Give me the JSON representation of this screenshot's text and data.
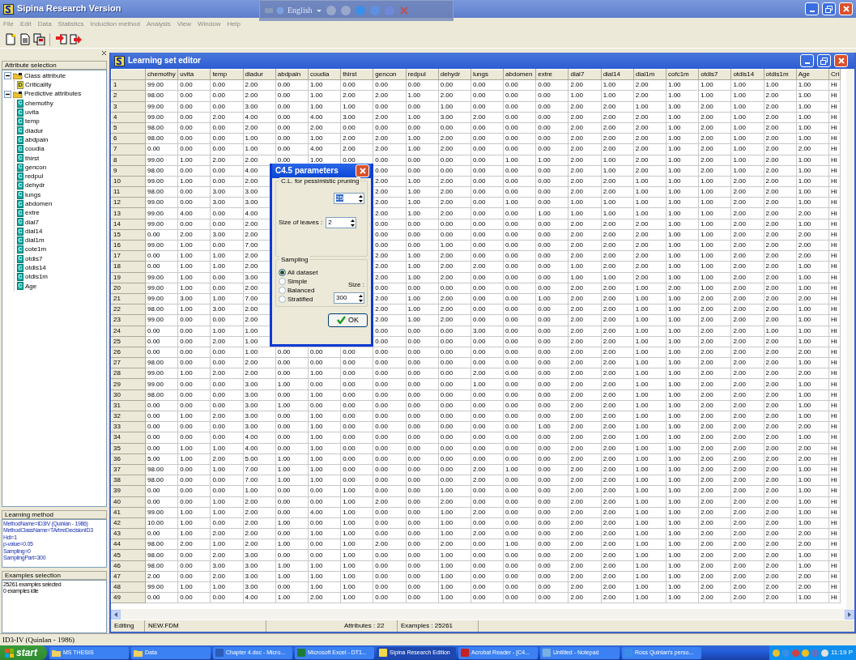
{
  "window": {
    "title": "Sipina Research Version"
  },
  "language_bar": {
    "label": "English"
  },
  "menu": [
    "File",
    "Edit",
    "Data",
    "Statistics",
    "Induction method",
    "Analysis",
    "View",
    "Window",
    "Help"
  ],
  "toolbar": [
    {
      "kind": "new"
    },
    {
      "kind": "open"
    },
    {
      "kind": "save"
    },
    {
      "kind": "import"
    },
    {
      "kind": "export"
    }
  ],
  "sidebar": {
    "attribute_title": "Attribute selection",
    "tree": [
      {
        "label": "Class attribute",
        "expanded": true,
        "children": [
          {
            "label": "Criticality",
            "letter": "D",
            "kind": "discrete"
          }
        ]
      },
      {
        "label": "Predictive attributes",
        "expanded": true,
        "children": [
          {
            "label": "chemothy",
            "letter": "C",
            "kind": "continuous"
          },
          {
            "label": "uvita",
            "letter": "C",
            "kind": "continuous"
          },
          {
            "label": "temp",
            "letter": "C",
            "kind": "continuous"
          },
          {
            "label": "diadur",
            "letter": "C",
            "kind": "continuous"
          },
          {
            "label": "abdpain",
            "letter": "C",
            "kind": "continuous"
          },
          {
            "label": "coudia",
            "letter": "C",
            "kind": "continuous"
          },
          {
            "label": "thirst",
            "letter": "C",
            "kind": "continuous"
          },
          {
            "label": "gencon",
            "letter": "C",
            "kind": "continuous"
          },
          {
            "label": "redpul",
            "letter": "C",
            "kind": "continuous"
          },
          {
            "label": "dehydr",
            "letter": "C",
            "kind": "continuous"
          },
          {
            "label": "lungs",
            "letter": "C",
            "kind": "continuous"
          },
          {
            "label": "abdomen",
            "letter": "C",
            "kind": "continuous"
          },
          {
            "label": "extre",
            "letter": "C",
            "kind": "continuous"
          },
          {
            "label": "dial7",
            "letter": "C",
            "kind": "continuous"
          },
          {
            "label": "dial14",
            "letter": "C",
            "kind": "continuous"
          },
          {
            "label": "dial1m",
            "letter": "C",
            "kind": "continuous"
          },
          {
            "label": "cote1m",
            "letter": "C",
            "kind": "continuous"
          },
          {
            "label": "otdis7",
            "letter": "C",
            "kind": "continuous"
          },
          {
            "label": "otdis14",
            "letter": "C",
            "kind": "continuous"
          },
          {
            "label": "otdis1m",
            "letter": "C",
            "kind": "continuous"
          },
          {
            "label": "Age",
            "letter": "C",
            "kind": "continuous"
          }
        ]
      }
    ],
    "method_title": "Learning method",
    "method_lines": [
      "MethodName=ID3IV (Quinlan - 1986)",
      "MethodClassName=TArbreDecisionID3",
      "Hdl=1",
      "p-value=0.05",
      "Sampling=0",
      "SamplingPart=300"
    ],
    "examples_title": "Examples selection",
    "examples_lines": [
      "25261 examples selected",
      "0 examples idle"
    ]
  },
  "editor": {
    "title": "Learning set editor",
    "table": {
      "columns": [
        "chemothy",
        "uvita",
        "temp",
        "diadur",
        "abdpain",
        "coudia",
        "thirst",
        "gencon",
        "redpul",
        "dehydr",
        "lungs",
        "abdomen",
        "extre",
        "dial7",
        "dial14",
        "dial1m",
        "cofc1m",
        "otdis7",
        "otdis14",
        "otdis1m",
        "Age",
        "Cri"
      ],
      "rows": [
        {
          "header": "1",
          "cells": [
            "99.00",
            "0.00",
            "0.00",
            "2.00",
            "0.00",
            "1.00",
            "0.00",
            "0.00",
            "0.00",
            "0.00",
            "0.00",
            "0.00",
            "0.00",
            "2.00",
            "1.00",
            "2.00",
            "1.00",
            "1.00",
            "1.00",
            "1.00",
            "1.00",
            "Hi"
          ]
        },
        {
          "header": "2",
          "cells": [
            "98.00",
            "0.00",
            "0.00",
            "2.00",
            "0.00",
            "1.00",
            "2.00",
            "2.00",
            "1.00",
            "2.00",
            "0.00",
            "0.00",
            "0.00",
            "1.00",
            "1.00",
            "2.00",
            "1.00",
            "1.00",
            "1.00",
            "2.00",
            "1.00",
            "Hi"
          ]
        },
        {
          "header": "3",
          "cells": [
            "99.00",
            "0.00",
            "0.00",
            "3.00",
            "0.00",
            "1.00",
            "1.00",
            "0.00",
            "0.00",
            "1.00",
            "0.00",
            "0.00",
            "0.00",
            "2.00",
            "2.00",
            "1.00",
            "1.00",
            "2.00",
            "1.00",
            "2.00",
            "1.00",
            "Hi"
          ]
        },
        {
          "header": "4",
          "cells": [
            "99.00",
            "0.00",
            "2.00",
            "4.00",
            "0.00",
            "4.00",
            "3.00",
            "2.00",
            "1.00",
            "3.00",
            "2.00",
            "0.00",
            "0.00",
            "2.00",
            "2.00",
            "2.00",
            "1.00",
            "2.00",
            "1.00",
            "2.00",
            "1.00",
            "Hi"
          ]
        },
        {
          "header": "5",
          "cells": [
            "98.00",
            "0.00",
            "0.00",
            "2.00",
            "0.00",
            "2.00",
            "0.00",
            "0.00",
            "0.00",
            "0.00",
            "0.00",
            "0.00",
            "0.00",
            "2.00",
            "2.00",
            "2.00",
            "1.00",
            "2.00",
            "1.00",
            "2.00",
            "1.00",
            "Hi"
          ]
        },
        {
          "header": "6",
          "cells": [
            "98.00",
            "0.00",
            "0.00",
            "1.00",
            "0.00",
            "1.00",
            "2.00",
            "2.00",
            "1.00",
            "2.00",
            "0.00",
            "0.00",
            "0.00",
            "2.00",
            "2.00",
            "2.00",
            "1.00",
            "2.00",
            "1.00",
            "2.00",
            "1.00",
            "Hi"
          ]
        },
        {
          "header": "7",
          "cells": [
            "0.00",
            "0.00",
            "0.00",
            "1.00",
            "0.00",
            "4.00",
            "2.00",
            "2.00",
            "1.00",
            "2.00",
            "0.00",
            "0.00",
            "0.00",
            "2.00",
            "2.00",
            "2.00",
            "1.00",
            "2.00",
            "1.00",
            "2.00",
            "2.00",
            "Hi"
          ]
        },
        {
          "header": "8",
          "cells": [
            "99.00",
            "1.00",
            "2.00",
            "2.00",
            "0.00",
            "1.00",
            "0.00",
            "0.00",
            "0.00",
            "0.00",
            "0.00",
            "1.00",
            "1.00",
            "2.00",
            "1.00",
            "2.00",
            "1.00",
            "2.00",
            "1.00",
            "2.00",
            "1.00",
            "Hi"
          ]
        },
        {
          "header": "9",
          "cells": [
            "98.00",
            "0.00",
            "0.00",
            "4.00",
            null,
            null,
            null,
            "0.00",
            "0.00",
            "0.00",
            "0.00",
            "0.00",
            "0.00",
            "2.00",
            "1.00",
            "2.00",
            "1.00",
            "2.00",
            "1.00",
            "2.00",
            "1.00",
            "Hi"
          ]
        },
        {
          "header": "10",
          "cells": [
            "99.00",
            "1.00",
            "0.00",
            "2.00",
            null,
            null,
            null,
            "2.00",
            "1.00",
            "2.00",
            "0.00",
            "0.00",
            "0.00",
            "2.00",
            "2.00",
            "1.00",
            "1.00",
            "1.00",
            "2.00",
            "2.00",
            "1.00",
            "Hi"
          ]
        },
        {
          "header": "11",
          "cells": [
            "98.00",
            "0.00",
            "3.00",
            "3.00",
            null,
            null,
            null,
            "2.00",
            "1.00",
            "2.00",
            "0.00",
            "0.00",
            "0.00",
            "2.00",
            "2.00",
            "1.00",
            "1.00",
            "1.00",
            "2.00",
            "2.00",
            "1.00",
            "Hi"
          ]
        },
        {
          "header": "12",
          "cells": [
            "99.00",
            "0.00",
            "3.00",
            "3.00",
            null,
            null,
            null,
            "2.00",
            "1.00",
            "2.00",
            "0.00",
            "1.00",
            "0.00",
            "1.00",
            "1.00",
            "1.00",
            "1.00",
            "1.00",
            "2.00",
            "2.00",
            "1.00",
            "Hi"
          ]
        },
        {
          "header": "13",
          "cells": [
            "99.00",
            "4.00",
            "0.00",
            "4.00",
            null,
            null,
            null,
            "2.00",
            "1.00",
            "2.00",
            "0.00",
            "0.00",
            "1.00",
            "1.00",
            "1.00",
            "1.00",
            "1.00",
            "1.00",
            "2.00",
            "2.00",
            "2.00",
            "Hi"
          ]
        },
        {
          "header": "14",
          "cells": [
            "99.00",
            "0.00",
            "0.00",
            "2.00",
            null,
            null,
            null,
            "0.00",
            "0.00",
            "0.00",
            "0.00",
            "0.00",
            "0.00",
            "2.00",
            "2.00",
            "2.00",
            "1.00",
            "1.00",
            "2.00",
            "2.00",
            "1.00",
            "Hi"
          ]
        },
        {
          "header": "15",
          "cells": [
            "0.00",
            "2.00",
            "3.00",
            "2.00",
            null,
            null,
            null,
            "0.00",
            "0.00",
            "0.00",
            "0.00",
            "0.00",
            "0.00",
            "2.00",
            "2.00",
            "2.00",
            "1.00",
            "1.00",
            "2.00",
            "2.00",
            "2.00",
            "Hi"
          ]
        },
        {
          "header": "16",
          "cells": [
            "99.00",
            "1.00",
            "0.00",
            "7.00",
            null,
            null,
            null,
            "0.00",
            "0.00",
            "1.00",
            "0.00",
            "0.00",
            "0.00",
            "2.00",
            "2.00",
            "2.00",
            "1.00",
            "1.00",
            "2.00",
            "2.00",
            "2.00",
            "Hi"
          ]
        },
        {
          "header": "17",
          "cells": [
            "0.00",
            "1.00",
            "1.00",
            "2.00",
            null,
            null,
            null,
            "2.00",
            "1.00",
            "2.00",
            "0.00",
            "0.00",
            "0.00",
            "2.00",
            "2.00",
            "2.00",
            "1.00",
            "1.00",
            "2.00",
            "2.00",
            "2.00",
            "Hi"
          ]
        },
        {
          "header": "18",
          "cells": [
            "0.00",
            "1.00",
            "1.00",
            "2.00",
            null,
            null,
            null,
            "2.00",
            "1.00",
            "2.00",
            "2.00",
            "0.00",
            "0.00",
            "1.00",
            "2.00",
            "2.00",
            "1.00",
            "1.00",
            "2.00",
            "2.00",
            "1.00",
            "Hi"
          ]
        },
        {
          "header": "19",
          "cells": [
            "99.00",
            "1.00",
            "0.00",
            "3.00",
            null,
            null,
            null,
            "2.00",
            "1.00",
            "2.00",
            "0.00",
            "0.00",
            "0.00",
            "1.00",
            "1.00",
            "2.00",
            "1.00",
            "1.00",
            "2.00",
            "2.00",
            "1.00",
            "Hi"
          ]
        },
        {
          "header": "20",
          "cells": [
            "99.00",
            "1.00",
            "0.00",
            "2.00",
            null,
            null,
            null,
            "0.00",
            "0.00",
            "0.00",
            "0.00",
            "0.00",
            "0.00",
            "2.00",
            "2.00",
            "1.00",
            "2.00",
            "1.00",
            "2.00",
            "2.00",
            "1.00",
            "Hi"
          ]
        },
        {
          "header": "21",
          "cells": [
            "99.00",
            "3.00",
            "1.00",
            "7.00",
            null,
            null,
            null,
            "2.00",
            "1.00",
            "2.00",
            "0.00",
            "0.00",
            "1.00",
            "2.00",
            "2.00",
            "1.00",
            "1.00",
            "2.00",
            "2.00",
            "2.00",
            "2.00",
            "Hi"
          ]
        },
        {
          "header": "22",
          "cells": [
            "98.00",
            "1.00",
            "3.00",
            "2.00",
            null,
            null,
            null,
            "2.00",
            "1.00",
            "2.00",
            "0.00",
            "0.00",
            "0.00",
            "2.00",
            "2.00",
            "1.00",
            "1.00",
            "2.00",
            "2.00",
            "2.00",
            "1.00",
            "Hi"
          ]
        },
        {
          "header": "23",
          "cells": [
            "99.00",
            "0.00",
            "0.00",
            "2.00",
            null,
            null,
            null,
            "2.00",
            "1.00",
            "2.00",
            "0.00",
            "0.00",
            "0.00",
            "2.00",
            "2.00",
            "1.00",
            "1.00",
            "2.00",
            "2.00",
            "2.00",
            "1.00",
            "Hi"
          ]
        },
        {
          "header": "24",
          "cells": [
            "0.00",
            "0.00",
            "1.00",
            "1.00",
            null,
            null,
            null,
            "0.00",
            "0.00",
            "0.00",
            "3.00",
            "0.00",
            "0.00",
            "2.00",
            "2.00",
            "1.00",
            "1.00",
            "2.00",
            "2.00",
            "1.00",
            "1.00",
            "Hi"
          ]
        },
        {
          "header": "25",
          "cells": [
            "0.00",
            "0.00",
            "2.00",
            "1.00",
            null,
            null,
            null,
            "0.00",
            "0.00",
            "0.00",
            "0.00",
            "0.00",
            "0.00",
            "2.00",
            "2.00",
            "1.00",
            "1.00",
            "2.00",
            "2.00",
            "2.00",
            "1.00",
            "Hi"
          ]
        },
        {
          "header": "26",
          "cells": [
            "0.00",
            "0.00",
            "0.00",
            "1.00",
            "0.00",
            "0.00",
            "0.00",
            "0.00",
            "0.00",
            "0.00",
            "0.00",
            "0.00",
            "0.00",
            "2.00",
            "2.00",
            "1.00",
            "1.00",
            "2.00",
            "2.00",
            "2.00",
            "2.00",
            "Hi"
          ]
        },
        {
          "header": "27",
          "cells": [
            "98.00",
            "0.00",
            "0.00",
            "2.00",
            "0.00",
            "0.00",
            "0.00",
            "0.00",
            "0.00",
            "0.00",
            "0.00",
            "0.00",
            "0.00",
            "2.00",
            "2.00",
            "1.00",
            "1.00",
            "2.00",
            "2.00",
            "2.00",
            "1.00",
            "Hi"
          ]
        },
        {
          "header": "28",
          "cells": [
            "99.00",
            "1.00",
            "2.00",
            "2.00",
            "0.00",
            "1.00",
            "0.00",
            "0.00",
            "0.00",
            "0.00",
            "2.00",
            "0.00",
            "0.00",
            "2.00",
            "2.00",
            "1.00",
            "1.00",
            "2.00",
            "2.00",
            "2.00",
            "2.00",
            "Hi"
          ]
        },
        {
          "header": "29",
          "cells": [
            "99.00",
            "0.00",
            "0.00",
            "3.00",
            "1.00",
            "0.00",
            "0.00",
            "0.00",
            "0.00",
            "0.00",
            "1.00",
            "0.00",
            "0.00",
            "2.00",
            "2.00",
            "1.00",
            "1.00",
            "2.00",
            "2.00",
            "2.00",
            "1.00",
            "Hi"
          ]
        },
        {
          "header": "30",
          "cells": [
            "98.00",
            "0.00",
            "0.00",
            "3.00",
            "0.00",
            "1.00",
            "0.00",
            "0.00",
            "0.00",
            "0.00",
            "0.00",
            "0.00",
            "0.00",
            "2.00",
            "2.00",
            "1.00",
            "1.00",
            "2.00",
            "2.00",
            "2.00",
            "1.00",
            "Hi"
          ]
        },
        {
          "header": "31",
          "cells": [
            "0.00",
            "0.00",
            "0.00",
            "3.00",
            "1.00",
            "0.00",
            "0.00",
            "0.00",
            "0.00",
            "0.00",
            "0.00",
            "0.00",
            "0.00",
            "2.00",
            "2.00",
            "1.00",
            "1.00",
            "2.00",
            "2.00",
            "2.00",
            "1.00",
            "Hi"
          ]
        },
        {
          "header": "32",
          "cells": [
            "0.00",
            "1.00",
            "2.00",
            "3.00",
            "0.00",
            "1.00",
            "0.00",
            "0.00",
            "0.00",
            "0.00",
            "0.00",
            "0.00",
            "0.00",
            "2.00",
            "2.00",
            "1.00",
            "1.00",
            "2.00",
            "2.00",
            "2.00",
            "1.00",
            "Hi"
          ]
        },
        {
          "header": "33",
          "cells": [
            "0.00",
            "0.00",
            "0.00",
            "3.00",
            "0.00",
            "1.00",
            "0.00",
            "0.00",
            "0.00",
            "0.00",
            "0.00",
            "0.00",
            "1.00",
            "2.00",
            "2.00",
            "1.00",
            "1.00",
            "2.00",
            "2.00",
            "2.00",
            "2.00",
            "Hi"
          ]
        },
        {
          "header": "34",
          "cells": [
            "0.00",
            "0.00",
            "0.00",
            "4.00",
            "0.00",
            "1.00",
            "0.00",
            "0.00",
            "0.00",
            "0.00",
            "0.00",
            "0.00",
            "0.00",
            "2.00",
            "2.00",
            "1.00",
            "1.00",
            "2.00",
            "2.00",
            "2.00",
            "1.00",
            "Hi"
          ]
        },
        {
          "header": "35",
          "cells": [
            "0.00",
            "1.00",
            "1.00",
            "4.00",
            "0.00",
            "1.00",
            "0.00",
            "0.00",
            "0.00",
            "0.00",
            "0.00",
            "0.00",
            "0.00",
            "2.00",
            "2.00",
            "1.00",
            "1.00",
            "2.00",
            "2.00",
            "2.00",
            "2.00",
            "Hi"
          ]
        },
        {
          "header": "36",
          "cells": [
            "5.00",
            "1.00",
            "2.00",
            "5.00",
            "1.00",
            "1.00",
            "0.00",
            "0.00",
            "0.00",
            "0.00",
            "0.00",
            "0.00",
            "0.00",
            "2.00",
            "2.00",
            "1.00",
            "1.00",
            "2.00",
            "2.00",
            "2.00",
            "2.00",
            "Hi"
          ]
        },
        {
          "header": "37",
          "cells": [
            "98.00",
            "0.00",
            "1.00",
            "7.00",
            "1.00",
            "1.00",
            "0.00",
            "0.00",
            "0.00",
            "0.00",
            "2.00",
            "1.00",
            "0.00",
            "2.00",
            "2.00",
            "1.00",
            "1.00",
            "2.00",
            "2.00",
            "2.00",
            "1.00",
            "Hi"
          ]
        },
        {
          "header": "38",
          "cells": [
            "98.00",
            "0.00",
            "0.00",
            "7.00",
            "1.00",
            "1.00",
            "0.00",
            "0.00",
            "0.00",
            "0.00",
            "2.00",
            "0.00",
            "0.00",
            "2.00",
            "2.00",
            "1.00",
            "1.00",
            "2.00",
            "2.00",
            "2.00",
            "1.00",
            "Hi"
          ]
        },
        {
          "header": "39",
          "cells": [
            "0.00",
            "0.00",
            "0.00",
            "1.00",
            "0.00",
            "0.00",
            "1.00",
            "0.00",
            "0.00",
            "1.00",
            "0.00",
            "0.00",
            "0.00",
            "2.00",
            "2.00",
            "1.00",
            "1.00",
            "2.00",
            "2.00",
            "2.00",
            "1.00",
            "Hi"
          ]
        },
        {
          "header": "40",
          "cells": [
            "0.00",
            "0.00",
            "1.00",
            "2.00",
            "0.00",
            "0.00",
            "1.00",
            "2.00",
            "0.00",
            "2.00",
            "0.00",
            "0.00",
            "0.00",
            "2.00",
            "2.00",
            "1.00",
            "1.00",
            "2.00",
            "2.00",
            "2.00",
            "1.00",
            "Hi"
          ]
        },
        {
          "header": "41",
          "cells": [
            "99.00",
            "1.00",
            "1.00",
            "2.00",
            "0.00",
            "4.00",
            "1.00",
            "0.00",
            "0.00",
            "1.00",
            "2.00",
            "0.00",
            "0.00",
            "2.00",
            "2.00",
            "1.00",
            "1.00",
            "2.00",
            "2.00",
            "2.00",
            "1.00",
            "Hi"
          ]
        },
        {
          "header": "42",
          "cells": [
            "10.00",
            "1.00",
            "0.00",
            "2.00",
            "1.00",
            "0.00",
            "1.00",
            "0.00",
            "0.00",
            "1.00",
            "0.00",
            "0.00",
            "0.00",
            "2.00",
            "2.00",
            "1.00",
            "1.00",
            "2.00",
            "2.00",
            "2.00",
            "1.00",
            "Hi"
          ]
        },
        {
          "header": "43",
          "cells": [
            "0.00",
            "1.00",
            "2.00",
            "2.00",
            "0.00",
            "1.00",
            "1.00",
            "0.00",
            "0.00",
            "1.00",
            "2.00",
            "0.00",
            "0.00",
            "2.00",
            "2.00",
            "1.00",
            "1.00",
            "2.00",
            "2.00",
            "2.00",
            "2.00",
            "Hi"
          ]
        },
        {
          "header": "44",
          "cells": [
            "98.00",
            "2.00",
            "1.00",
            "2.00",
            "1.00",
            "0.00",
            "1.00",
            "2.00",
            "0.00",
            "2.00",
            "0.00",
            "1.00",
            "0.00",
            "2.00",
            "2.00",
            "1.00",
            "1.00",
            "2.00",
            "2.00",
            "2.00",
            "2.00",
            "Hi"
          ]
        },
        {
          "header": "45",
          "cells": [
            "98.00",
            "0.00",
            "2.00",
            "3.00",
            "0.00",
            "0.00",
            "1.00",
            "0.00",
            "0.00",
            "1.00",
            "0.00",
            "0.00",
            "0.00",
            "2.00",
            "2.00",
            "1.00",
            "1.00",
            "2.00",
            "2.00",
            "2.00",
            "1.00",
            "Hi"
          ]
        },
        {
          "header": "46",
          "cells": [
            "98.00",
            "0.00",
            "3.00",
            "3.00",
            "1.00",
            "1.00",
            "1.00",
            "0.00",
            "0.00",
            "1.00",
            "0.00",
            "0.00",
            "0.00",
            "2.00",
            "2.00",
            "1.00",
            "1.00",
            "2.00",
            "2.00",
            "2.00",
            "1.00",
            "Hi"
          ]
        },
        {
          "header": "47",
          "cells": [
            "2.00",
            "0.00",
            "2.00",
            "3.00",
            "1.00",
            "1.00",
            "1.00",
            "0.00",
            "0.00",
            "1.00",
            "0.00",
            "0.00",
            "0.00",
            "2.00",
            "2.00",
            "1.00",
            "1.00",
            "2.00",
            "2.00",
            "2.00",
            "2.00",
            "Hi"
          ]
        },
        {
          "header": "48",
          "cells": [
            "99.00",
            "1.00",
            "1.00",
            "3.00",
            "0.00",
            "1.00",
            "1.00",
            "0.00",
            "0.00",
            "1.00",
            "0.00",
            "0.00",
            "0.00",
            "2.00",
            "2.00",
            "1.00",
            "1.00",
            "2.00",
            "2.00",
            "2.00",
            "2.00",
            "Hi"
          ]
        },
        {
          "header": "49",
          "cells": [
            "0.00",
            "0.00",
            "0.00",
            "4.00",
            "1.00",
            "2.00",
            "1.00",
            "0.00",
            "0.00",
            "1.00",
            "0.00",
            "0.00",
            "0.00",
            "2.00",
            "2.00",
            "1.00",
            "1.00",
            "2.00",
            "2.00",
            "2.00",
            "1.00",
            "Hi"
          ]
        }
      ]
    },
    "status": [
      "Editing",
      "NEW.FDM",
      "Attributes : 22",
      "Examples : 25261"
    ]
  },
  "dialog": {
    "title": "C4.5 parameters",
    "cl_group": "C.L. for pessimistic pruning",
    "cl_value": "25",
    "leaves_label": "Size of leaves :",
    "leaves_value": "2",
    "sampling_group": "Sampling",
    "sampling_options": [
      {
        "label": "All dataset",
        "selected": true
      },
      {
        "label": "Simple",
        "selected": false
      },
      {
        "label": "Balanced",
        "selected": false
      },
      {
        "label": "Stratified",
        "selected": false
      }
    ],
    "size_label": "Size :",
    "size_value": "300",
    "ok": "OK"
  },
  "status_bar": "ID3-IV (Quinlan - 1986)",
  "taskbar": {
    "start": "start",
    "items": [
      {
        "label": "MS THESIS",
        "kind": "folder",
        "selected": false
      },
      {
        "label": "Data",
        "kind": "folder",
        "selected": false
      },
      {
        "label": "Chapter 4.doc - Micro...",
        "kind": "word",
        "selected": false
      },
      {
        "label": "Microsoft Excel - DT1...",
        "kind": "excel",
        "selected": false
      },
      {
        "label": "Sipina Research Edition",
        "kind": "app",
        "selected": true
      },
      {
        "label": "Acrobat Reader - [C4...",
        "kind": "pdf",
        "selected": false
      },
      {
        "label": "Untitled - Notepad",
        "kind": "notepad",
        "selected": false
      },
      {
        "label": "Ross Quinlan's perso...",
        "kind": "browser",
        "selected": false
      }
    ],
    "clock": "11:19 P"
  }
}
